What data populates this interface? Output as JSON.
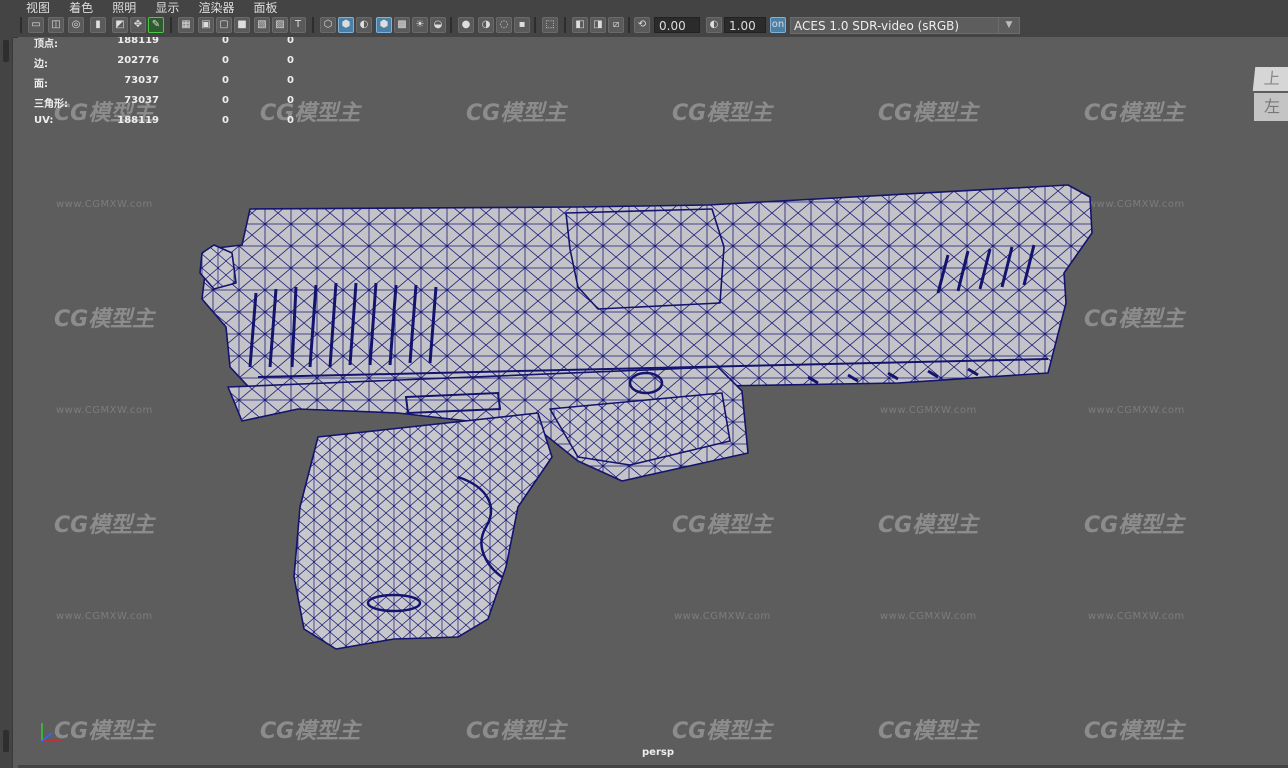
{
  "menu": {
    "items": [
      "视图",
      "着色",
      "照明",
      "显示",
      "渲染器",
      "面板"
    ]
  },
  "toolbar": {
    "exposure_value": "0.00",
    "gamma_value": "1.00",
    "colorspace": "ACES 1.0 SDR-video (sRGB)",
    "icons": [
      "camera-icon",
      "camera-attributes-icon",
      "bookmark-icon",
      "image-plane-icon",
      "grid-icon",
      "film-gate-icon",
      "resolution-gate-icon",
      "wireframe-icon",
      "smooth-shade-icon",
      "textured-icon",
      "lighting-icon",
      "shadow-icon",
      "isolate-icon",
      "xray-icon",
      "exposure-icon",
      "gamma-icon",
      "color-management-icon"
    ]
  },
  "hud": {
    "rows": [
      {
        "label": "顶点:",
        "v1": "188119",
        "v2": "0",
        "v3": "0"
      },
      {
        "label": "边:",
        "v1": "202776",
        "v2": "0",
        "v3": "0"
      },
      {
        "label": "面:",
        "v1": "73037",
        "v2": "0",
        "v3": "0"
      },
      {
        "label": "三角形:",
        "v1": "73037",
        "v2": "0",
        "v3": "0"
      },
      {
        "label": "UV:",
        "v1": "188119",
        "v2": "0",
        "v3": "0"
      }
    ]
  },
  "watermark": {
    "brand": "CG模型主",
    "url": "www.CGMXW.com"
  },
  "viewcube": {
    "top": "上",
    "front": "左"
  },
  "camera": {
    "name": "persp"
  },
  "colors": {
    "wire": "#1a1a7a",
    "surface": "#c8c8cc",
    "background": "#5d5d5d"
  }
}
